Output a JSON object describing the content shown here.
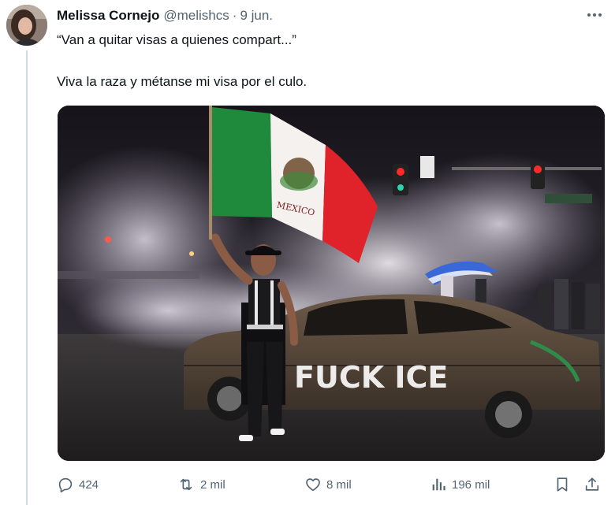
{
  "tweet": {
    "author_name": "Melissa Cornejo",
    "author_handle": "@melishcs",
    "separator": "·",
    "timestamp": "9 jun.",
    "quote_line": "“Van a quitar visas a quienes compart...”",
    "body_line": "Viva la raza y métanse mi visa por el culo."
  },
  "media": {
    "flag_text": "MEXICO",
    "graffiti": "FUCK ICE"
  },
  "actions": {
    "replies": "424",
    "reposts": "2 mil",
    "likes": "8 mil",
    "views": "196 mil"
  },
  "icons": {
    "more": "more-horizontal-icon",
    "reply": "reply-icon",
    "repost": "repost-icon",
    "like": "heart-icon",
    "views": "views-icon",
    "bookmark": "bookmark-icon",
    "share": "share-icon"
  },
  "colors": {
    "text_primary": "#0f1419",
    "text_secondary": "#536471",
    "divider": "#cfd9de"
  }
}
